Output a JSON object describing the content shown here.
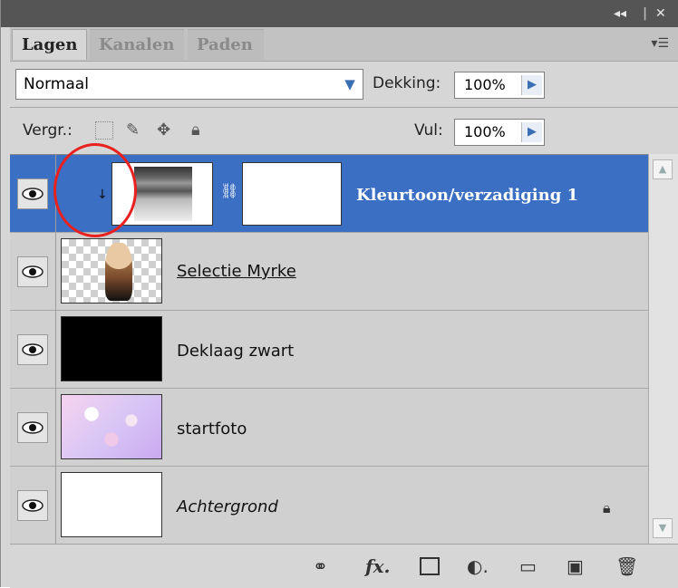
{
  "tabs": [
    {
      "label": "Lagen",
      "active": true
    },
    {
      "label": "Kanalen",
      "active": false
    },
    {
      "label": "Paden",
      "active": false
    }
  ],
  "blend_mode": {
    "value": "Normaal"
  },
  "opacity": {
    "label": "Dekking:",
    "value": "100%"
  },
  "lock": {
    "label": "Vergr.:"
  },
  "fill": {
    "label": "Vul:",
    "value": "100%"
  },
  "layers": [
    {
      "name": "Kleurtoon/verzadiging 1",
      "type": "adjustment",
      "selected": true
    },
    {
      "name": "Selectie Myrke",
      "type": "image"
    },
    {
      "name": "Deklaag zwart",
      "type": "fill"
    },
    {
      "name": "startfoto",
      "type": "image"
    },
    {
      "name": "Achtergrond",
      "type": "background",
      "locked": true
    }
  ],
  "bottom_icons": [
    "link-icon",
    "fx-icon",
    "mask-icon",
    "adjustment-icon",
    "group-folder-icon",
    "new-layer-icon",
    "trash-icon"
  ],
  "icons": {
    "eye": "eye-icon",
    "lock": "lock-icon",
    "menu": "panel-menu-icon"
  },
  "colors": {
    "selection": "#3a6fc4",
    "annotation": "#e8211e"
  }
}
